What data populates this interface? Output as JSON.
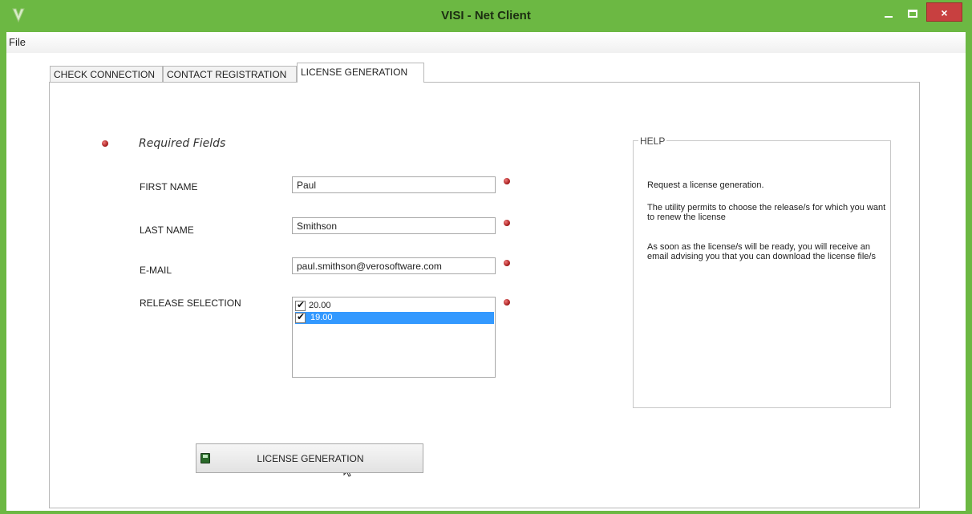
{
  "window": {
    "title": "VISI - Net Client",
    "accent": "#6cb843",
    "close_symbol": "×"
  },
  "menu": {
    "file": "File"
  },
  "tabs": [
    {
      "label": "CHECK CONNECTION"
    },
    {
      "label": "CONTACT REGISTRATION"
    },
    {
      "label": "LICENSE GENERATION"
    }
  ],
  "form": {
    "required_label": "Required Fields",
    "first_name_label": "FIRST NAME",
    "first_name_value": "Paul",
    "last_name_label": "LAST NAME",
    "last_name_value": "Smithson",
    "email_label": "E-MAIL",
    "email_value": "paul.smithson@verosoftware.com",
    "release_label": "RELEASE SELECTION",
    "releases": [
      {
        "label": "20.00",
        "checked": true,
        "selected": false
      },
      {
        "label": "19.00",
        "checked": true,
        "selected": true
      }
    ],
    "generate_button": "LICENSE GENERATION"
  },
  "help": {
    "title": "HELP",
    "line1": "Request a license generation.",
    "line2": "The utility permits to choose the release/s for which you want to renew the license",
    "line3": "As soon as the license/s will be ready, you will receive an email advising you that you can download the license file/s"
  },
  "icons": {
    "app": "app-logo-icon",
    "required": "required-dot-icon",
    "generate": "save-disk-icon",
    "cursor": "mouse-pointer-icon"
  },
  "colors": {
    "required_dot": "#b01c1c",
    "selection": "#3399ff",
    "close_button": "#c84040"
  }
}
